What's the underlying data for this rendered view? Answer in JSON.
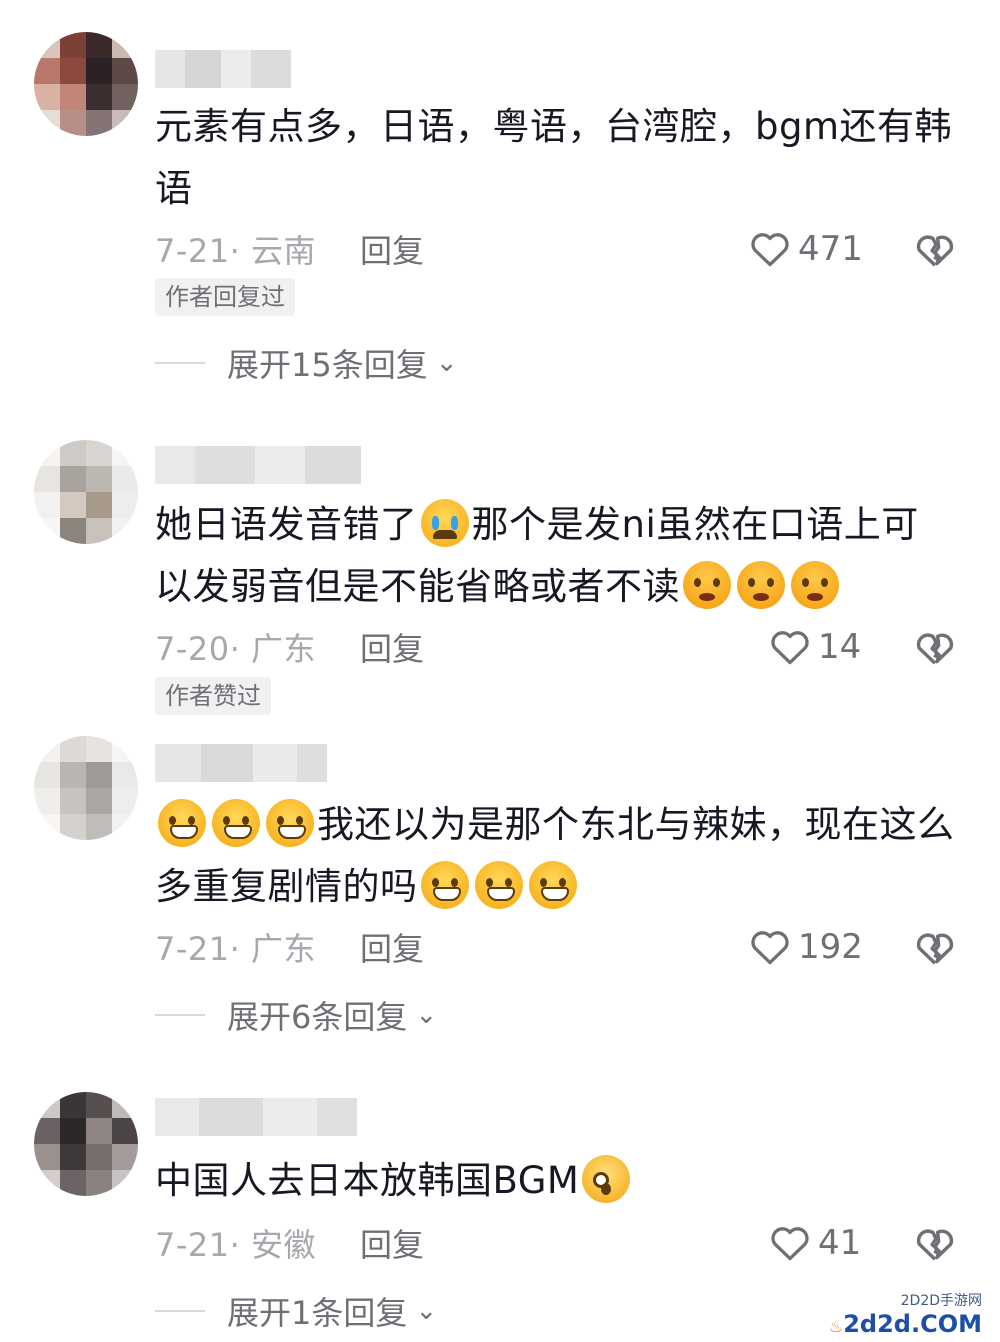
{
  "comments": [
    {
      "text": "元素有点多，日语，粤语，台湾腔，bgm还有韩语",
      "date": "7-21· 云南",
      "reply_label": "回复",
      "likes": "471",
      "tag": "作者回复过",
      "expand": "展开15条回复"
    },
    {
      "text_parts": [
        "她日语发音错了",
        "那个是发ni虽然在口语上可以发弱音但是不能省略或者不读"
      ],
      "date": "7-20· 广东",
      "reply_label": "回复",
      "likes": "14",
      "tag": "作者赞过"
    },
    {
      "text_parts": [
        "我还以为是那个东北与辣妹，现在这么多重复剧情的吗"
      ],
      "date": "7-21· 广东",
      "reply_label": "回复",
      "likes": "192",
      "expand": "展开6条回复"
    },
    {
      "text_parts": [
        "中国人去日本放韩国BGM"
      ],
      "date": "7-21· 安徽",
      "reply_label": "回复",
      "likes": "41",
      "expand": "展开1条回复"
    }
  ],
  "icons": {
    "like": "heart-outline-icon",
    "dislike": "broken-heart-icon",
    "expand": "chevron-down-icon"
  },
  "watermark": {
    "small": "2D2D手游网",
    "big": "2d2d.COM"
  },
  "colors": {
    "text": "#161823",
    "secondary": "#a7a8ad",
    "action": "#6f7076",
    "tag_bg": "#f1f1f2"
  }
}
